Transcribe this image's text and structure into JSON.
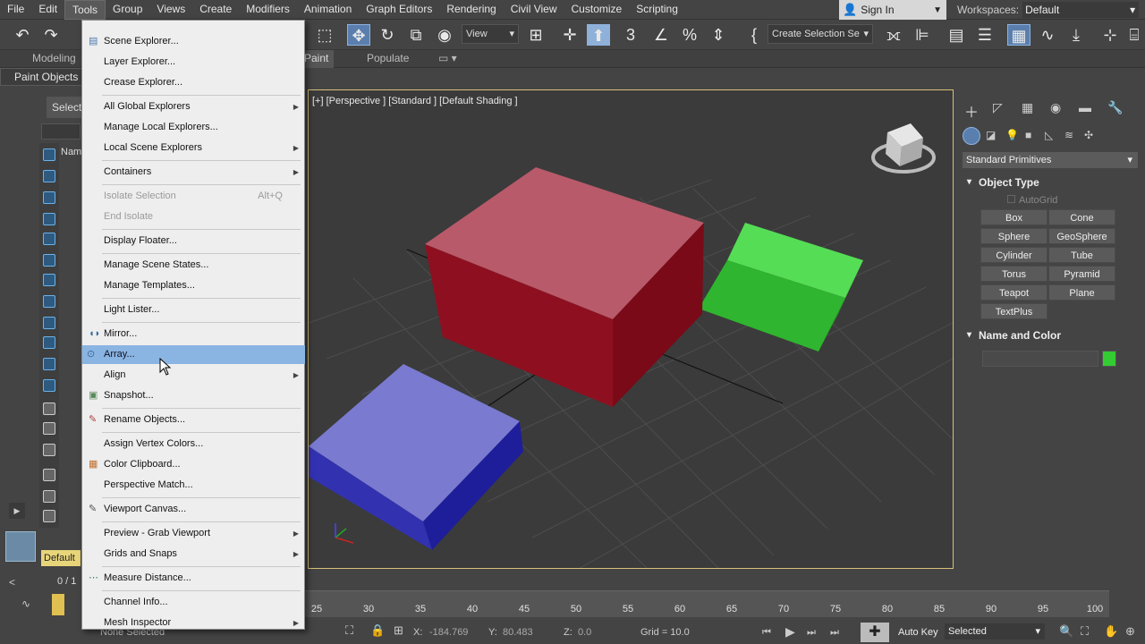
{
  "menubar": {
    "items": [
      "File",
      "Edit",
      "Tools",
      "Group",
      "Views",
      "Create",
      "Modifiers",
      "Animation",
      "Graph Editors",
      "Rendering",
      "Civil View",
      "Customize",
      "Scripting"
    ],
    "active": "Tools",
    "signin": "Sign In",
    "workspaces_label": "Workspaces:",
    "workspaces_value": "Default"
  },
  "toolbar": {
    "view_dropdown": "View",
    "selection_set": "Create Selection Se"
  },
  "ribbon": {
    "tabs": [
      "Modeling",
      "Paint",
      "Populate"
    ],
    "sub_label": "Paint Objects"
  },
  "scene": {
    "select_label": "Select",
    "name_col": "Nam",
    "layer_default": "Default"
  },
  "viewport": {
    "label": "[+] [Perspective ] [Standard ] [Default Shading ]",
    "colors": {
      "red": "#8b1020",
      "green": "#22aa22",
      "blue": "#2a2aa8"
    }
  },
  "command_panel": {
    "category": "Standard Primitives",
    "object_type": "Object Type",
    "autogrid": "AutoGrid",
    "buttons": [
      "Box",
      "Cone",
      "Sphere",
      "GeoSphere",
      "Cylinder",
      "Tube",
      "Torus",
      "Pyramid",
      "Teapot",
      "Plane",
      "TextPlus"
    ],
    "name_and_color": "Name and Color",
    "object_color": "#33cc33"
  },
  "tools_menu": {
    "items": [
      {
        "label": "Scene Explorer...",
        "icon": "scene-explorer-icon"
      },
      {
        "label": "Layer Explorer..."
      },
      {
        "label": "Crease Explorer..."
      },
      {
        "label": "All Global Explorers",
        "sub": true
      },
      {
        "label": "Manage Local Explorers..."
      },
      {
        "label": "Local Scene Explorers",
        "sub": true
      },
      {
        "label": "Containers",
        "sub": true
      },
      {
        "label": "Isolate Selection",
        "shortcut": "Alt+Q",
        "disabled": true
      },
      {
        "label": "End Isolate",
        "disabled": true
      },
      {
        "label": "Display Floater..."
      },
      {
        "label": "Manage Scene States..."
      },
      {
        "label": "Manage Templates..."
      },
      {
        "label": "Light Lister..."
      },
      {
        "label": "Mirror...",
        "icon": "mirror-icon"
      },
      {
        "label": "Array...",
        "icon": "array-icon",
        "highlighted": true
      },
      {
        "label": "Align",
        "sub": true
      },
      {
        "label": "Snapshot...",
        "icon": "snapshot-icon"
      },
      {
        "label": "Rename Objects...",
        "icon": "rename-icon"
      },
      {
        "label": "Assign Vertex Colors..."
      },
      {
        "label": "Color Clipboard...",
        "icon": "color-clipboard-icon"
      },
      {
        "label": "Perspective Match..."
      },
      {
        "label": "Viewport Canvas...",
        "icon": "viewport-canvas-icon"
      },
      {
        "label": "Preview - Grab Viewport",
        "sub": true
      },
      {
        "label": "Grids and Snaps",
        "sub": true
      },
      {
        "label": "Measure Distance...",
        "icon": "measure-icon"
      },
      {
        "label": "Channel Info..."
      },
      {
        "label": "Mesh Inspector",
        "sub": true
      }
    ]
  },
  "timeline": {
    "frame": "0 / 1",
    "ticks": [
      "25",
      "30",
      "35",
      "40",
      "45",
      "50",
      "55",
      "60",
      "65",
      "70",
      "75",
      "80",
      "85",
      "90",
      "95",
      "100"
    ]
  },
  "status": {
    "selection": "None Selected",
    "x_label": "X:",
    "x_value": "-184.769",
    "y_label": "Y:",
    "y_value": "80.483",
    "z_label": "Z:",
    "z_value": "0.0",
    "grid": "Grid = 10.0",
    "autokey": "Auto Key",
    "selected": "Selected"
  }
}
